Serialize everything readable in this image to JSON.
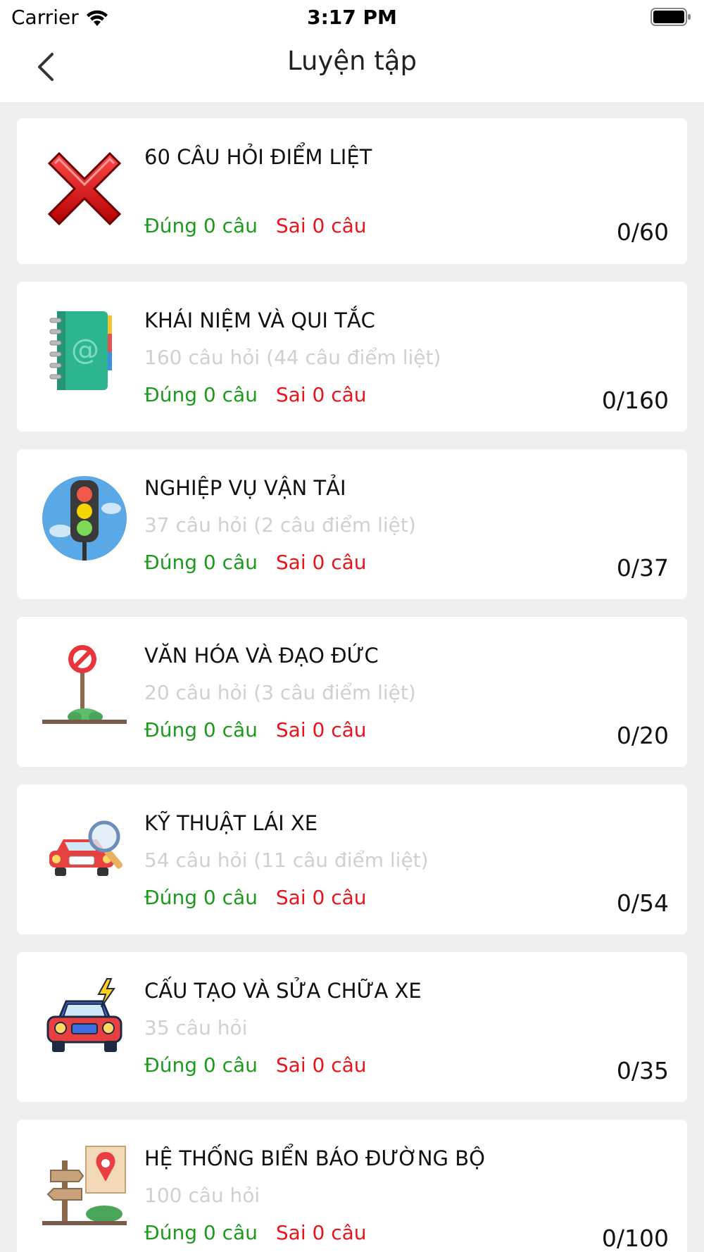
{
  "status_bar": {
    "carrier": "Carrier",
    "time": "3:17 PM"
  },
  "nav": {
    "title": "Luyện tập",
    "back_icon": "chevron-left-icon"
  },
  "colors": {
    "correct": "#1b9a1b",
    "wrong": "#e8141b",
    "subtitle": "#d0d0d0",
    "background": "#efefef"
  },
  "categories": [
    {
      "title": "60 CÂU HỎI ĐIỂM LIỆT",
      "subtitle": "",
      "correct": "Đúng 0  câu",
      "wrong": "Sai 0 câu",
      "progress": "0/60",
      "icon": "red-x-icon"
    },
    {
      "title": "KHÁI NIỆM VÀ QUI TẮC",
      "subtitle": "160 câu hỏi (44 câu điểm liệt)",
      "correct": "Đúng 0  câu",
      "wrong": "Sai 0 câu",
      "progress": "0/160",
      "icon": "address-book-icon"
    },
    {
      "title": "NGHIỆP VỤ VẬN TẢI",
      "subtitle": "37 câu hỏi (2 câu điểm liệt)",
      "correct": "Đúng 0  câu",
      "wrong": "Sai 0 câu",
      "progress": "0/37",
      "icon": "traffic-light-icon"
    },
    {
      "title": "VĂN HÓA VÀ ĐẠO ĐỨC",
      "subtitle": "20 câu hỏi (3 câu điểm liệt)",
      "correct": "Đúng 0  câu",
      "wrong": "Sai 0 câu",
      "progress": "0/20",
      "icon": "no-entry-sign-icon"
    },
    {
      "title": "KỸ THUẬT LÁI XE",
      "subtitle": "54 câu hỏi (11 câu điểm liệt)",
      "correct": "Đúng 0  câu",
      "wrong": "Sai 0 câu",
      "progress": "0/54",
      "icon": "car-magnifier-icon"
    },
    {
      "title": "CẤU TẠO VÀ SỬA CHỮA XE",
      "subtitle": "35 câu hỏi",
      "correct": "Đúng 0  câu",
      "wrong": "Sai 0 câu",
      "progress": "0/35",
      "icon": "car-lightning-icon"
    },
    {
      "title": "HỆ THỐNG BIỂN BÁO ĐƯỜNG BỘ",
      "subtitle": "100 câu hỏi",
      "correct": "Đúng 0  câu",
      "wrong": "Sai 0 câu",
      "progress": "0/100",
      "icon": "signpost-map-icon"
    }
  ]
}
